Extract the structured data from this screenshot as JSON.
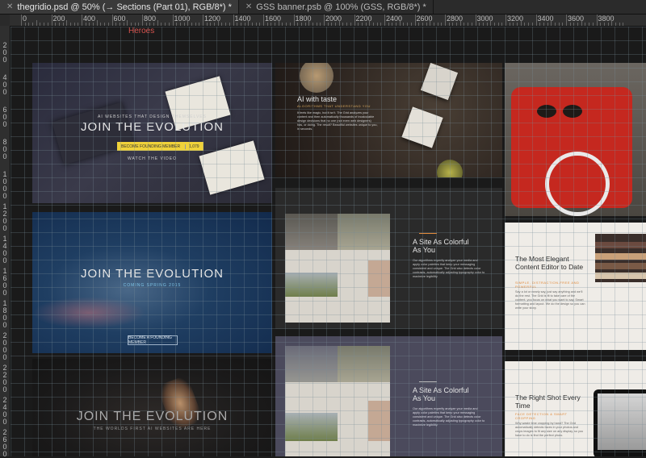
{
  "tabs": [
    {
      "label": "thegridio.psd @ 50% (→ Sections (Part 01), RGB/8*) *",
      "active": true
    },
    {
      "label": "GSS banner.psb @ 100% (GSS, RGB/8*) *",
      "active": false
    }
  ],
  "ruler": {
    "top_labels": [
      "0",
      "200",
      "400",
      "600",
      "800",
      "1000",
      "1200",
      "1400",
      "1600",
      "1800",
      "2000",
      "2200",
      "2400",
      "2600",
      "2800",
      "3000",
      "3200",
      "3400",
      "3600",
      "3800"
    ],
    "left_labels": [
      "200",
      "400",
      "600",
      "800",
      "1000",
      "1200",
      "1400",
      "1600",
      "1800",
      "2000",
      "2200",
      "2400",
      "2600"
    ]
  },
  "canvas": {
    "section_label": "Heroes",
    "hero1": {
      "sub": "AI WEBSITES THAT DESIGN THEMSELVES",
      "title": "JOIN THE EVOLUTION",
      "button": "BECOME FOUNDING MEMBER",
      "counter": "1,079",
      "link": "WATCH THE VIDEO"
    },
    "hero2": {
      "title": "JOIN THE EVOLUTION",
      "sub": "COMING SPRING 2015",
      "button": "BECOME A FOUNDING MEMBER"
    },
    "hero3": {
      "title": "JOIN THE EVOLUTION",
      "sub": "THE WORLDS FIRST AI WEBSITES ARE HERE"
    },
    "food": {
      "title": "AI with taste",
      "sub": "ALGORITHMS THAT UNDERSTAND YOU",
      "body": "It feels like magic, but it isn't. The Grid analyzes your content and then automatically thousands of incalculable design decisions that no one (not even web designers) has, or doing. The result? Beautiful websites unique to you, in seconds."
    },
    "colorful1": {
      "title": "A Site As Colorful As You",
      "body": "Our algorithms expertly analyze your media and apply color palettes that keep your messaging consistent and unique. The Grid also detects color contrasts, automatically adjusting typography color to maximize legibility."
    },
    "colorful2": {
      "title": "A Site As Colorful As You",
      "body": "Our algorithms expertly analyze your media and apply color palettes that keep your messaging consistent and unique. The Grid also detects color contrasts, automatically adjusting typography color to maximize legibility."
    },
    "elegant": {
      "title": "The Most Elegant Content Editor to Date",
      "sub": "SIMPLE, DISTRACTION-FREE AND POWERFUL",
      "body": "Say a lot or nearly say, just say anything and we'll do the rest. The Grid is fit to take care of the content, you focus on what you want to say. Smart formatting and layout. We do the design so you can write your story."
    },
    "rightshot": {
      "title": "The Right Shot Every Time",
      "sub": "FACE DETECTION & SMART CROPPING",
      "body": "Why waste time cropping by hand? The Grid automatically detects faces in your photos and crops images to fit any size on any display, so you have to do is find the perfect photo."
    }
  }
}
